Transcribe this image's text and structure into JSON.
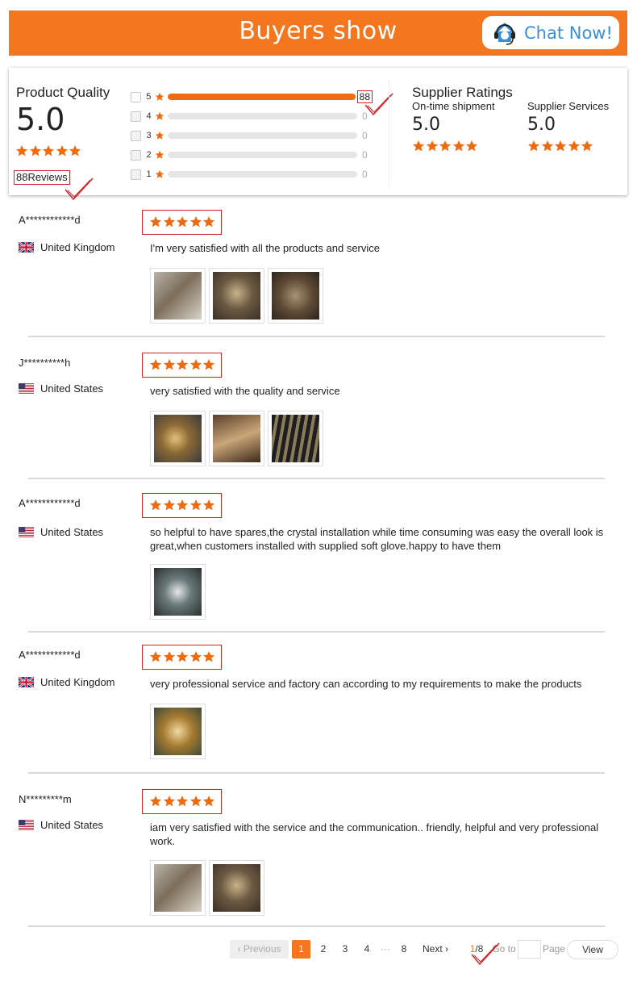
{
  "header": {
    "title": "Buyers show",
    "chat_button": "Chat Now!"
  },
  "colors": {
    "brand_orange": "#f4761f",
    "star_orange": "#f06a10",
    "annotation_red": "#d3242a",
    "chat_blue": "#3a8fd8"
  },
  "summary": {
    "product_quality_label": "Product Quality",
    "product_quality_score": "5.0",
    "product_quality_stars": 5,
    "reviews_label": "88Reviews",
    "distribution": [
      {
        "stars": "5",
        "count": "88",
        "fraction": 1.0
      },
      {
        "stars": "4",
        "count": "0",
        "fraction": 0
      },
      {
        "stars": "3",
        "count": "0",
        "fraction": 0
      },
      {
        "stars": "2",
        "count": "0",
        "fraction": 0
      },
      {
        "stars": "1",
        "count": "0",
        "fraction": 0
      }
    ],
    "supplier_ratings_title": "Supplier Ratings",
    "ontime_label": "On-time shipment",
    "ontime_score": "5.0",
    "services_label": "Supplier Services",
    "services_score": "5.0"
  },
  "reviews": [
    {
      "name": "A************d",
      "country": "United Kingdom",
      "flag": "uk-flag-icon",
      "stars": 5,
      "text": "I'm very satisfied with all the products and service",
      "photos": 3
    },
    {
      "name": "J**********h",
      "country": "United States",
      "flag": "us-flag-icon",
      "stars": 5,
      "text": "very satisfied with the quality and service",
      "photos": 3
    },
    {
      "name": "A************d",
      "country": "United States",
      "flag": "us-flag-icon",
      "stars": 5,
      "text": "so helpful to have spares,the crystal installation while time consuming was easy the overall look is great,when customers installed with supplied soft glove.happy to have them",
      "photos": 1
    },
    {
      "name": "A************d",
      "country": "United Kingdom",
      "flag": "uk-flag-icon",
      "stars": 5,
      "text": "very professional service and factory can according to my requirements to make the products",
      "photos": 1
    },
    {
      "name": "N*********m",
      "country": "United States",
      "flag": "us-flag-icon",
      "stars": 5,
      "text": "iam very satisfied with the service and the communication.. friendly, helpful and very professional work.",
      "photos": 2
    }
  ],
  "pagination": {
    "previous": "Previous",
    "pages": [
      "1",
      "2",
      "3",
      "4"
    ],
    "ellipsis": "···",
    "last_page": "8",
    "next": "Next",
    "current": "1",
    "total": "/8",
    "goto_label": "Go to",
    "page_label": "Page",
    "view_button": "View"
  }
}
